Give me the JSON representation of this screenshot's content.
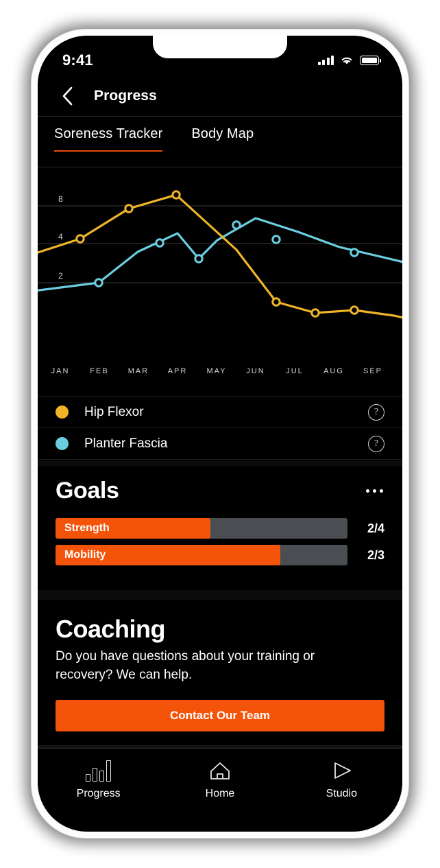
{
  "status_bar": {
    "time": "9:41",
    "cellular_icon": "signal-bars-icon",
    "wifi_icon": "wifi-icon",
    "battery_icon": "battery-icon"
  },
  "nav": {
    "back_icon": "chevron-left-icon",
    "title": "Progress"
  },
  "tabs": [
    {
      "label": "Soreness Tracker",
      "active": true
    },
    {
      "label": "Body Map",
      "active": false
    }
  ],
  "chart_data": {
    "type": "line",
    "title": "",
    "xlabel": "",
    "ylabel": "",
    "categories": [
      "JAN",
      "FEB",
      "MAR",
      "APR",
      "MAY",
      "JUN",
      "JUL",
      "AUG",
      "SEP"
    ],
    "y_ticks": [
      2,
      4,
      8
    ],
    "ylim": [
      0,
      10
    ],
    "grid": true,
    "legend_position": "below",
    "series": [
      {
        "name": "Hip Flexor",
        "color": "#F0B429",
        "values": [
          4.0,
          7.5,
          8.5,
          4.0,
          1.0,
          0.2,
          0.3,
          0.0,
          -0.4
        ]
      },
      {
        "name": "Planter Fascia",
        "color": "#6ACEE0",
        "values": [
          1.8,
          3.7,
          3.0,
          4.2,
          3.4,
          2.5,
          2.1,
          1.8,
          1.5
        ]
      }
    ]
  },
  "legend": {
    "items": [
      {
        "label": "Hip Flexor",
        "color": "#F0B429",
        "help_icon": "question-mark-icon"
      },
      {
        "label": "Planter Fascia",
        "color": "#6ACEE0",
        "help_icon": "question-mark-icon"
      }
    ]
  },
  "goals": {
    "title": "Goals",
    "more_icon": "overflow-menu-icon",
    "items": [
      {
        "label": "Strength",
        "count": "2/4",
        "percent": 53
      },
      {
        "label": "Mobility",
        "count": "2/3",
        "percent": 77
      }
    ]
  },
  "coaching": {
    "title": "Coaching",
    "body": "Do you have questions about your training or recovery? We can help.",
    "cta_label": "Contact Our Team"
  },
  "tabbar": [
    {
      "label": "Progress",
      "icon": "bar-chart-icon",
      "active": true
    },
    {
      "label": "Home",
      "icon": "house-icon",
      "active": false
    },
    {
      "label": "Studio",
      "icon": "play-triangle-icon",
      "active": false
    }
  ],
  "colors": {
    "accent_orange": "#F4530A",
    "tab_underline": "#E84A0C",
    "series_yellow": "#F0B429",
    "series_cyan": "#6ACEE0",
    "track_gray": "#4a4d52",
    "screen_black": "#000000"
  }
}
